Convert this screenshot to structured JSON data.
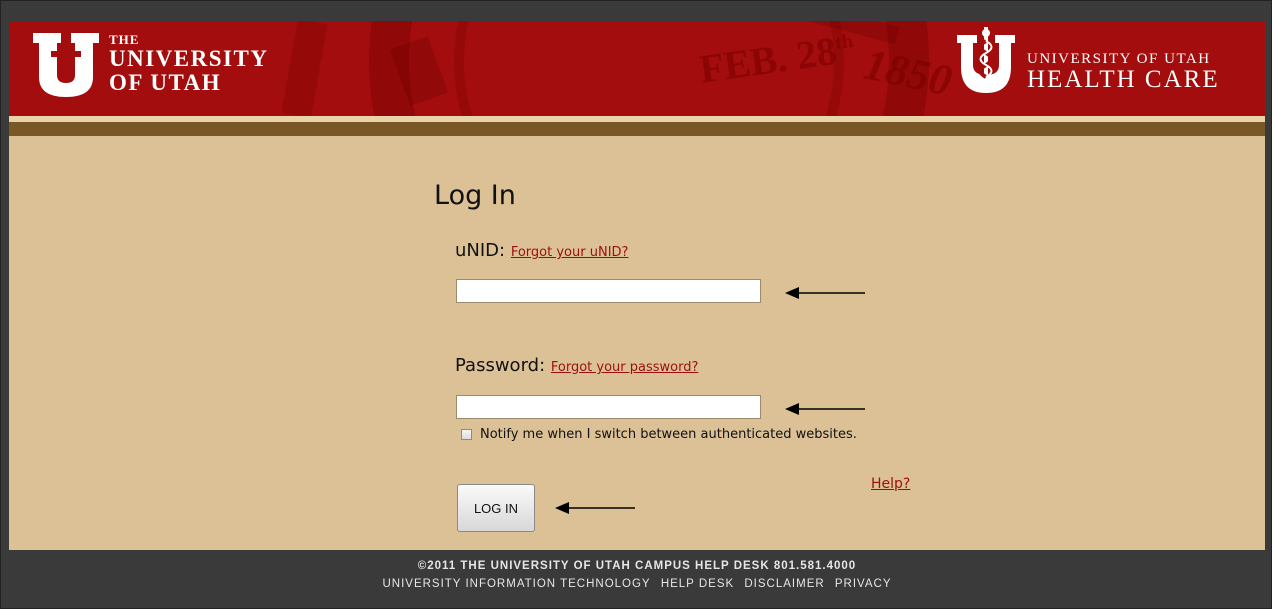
{
  "header": {
    "uu_the": "THE",
    "uu_line1": "UNIVERSITY",
    "uu_line2": "OF UTAH",
    "seal_date": "FEB. 28",
    "seal_sup": "th",
    "seal_year": "1850",
    "hc_line1": "UNIVERSITY OF UTAH",
    "hc_line2": "HEALTH CARE"
  },
  "form": {
    "title": "Log In",
    "unid_label": "uNID:",
    "unid_forgot": "Forgot your uNID?",
    "unid_value": "",
    "password_label": "Password:",
    "password_forgot": "Forgot your password?",
    "password_value": "",
    "notify_label": "Notify me when I switch between authenticated websites.",
    "notify_checked": false,
    "help_link": "Help?",
    "login_button": "LOG IN"
  },
  "footer": {
    "line1": "©2011 THE UNIVERSITY OF UTAH   CAMPUS HELP DESK   801.581.4000",
    "links": [
      "UNIVERSITY INFORMATION TECHNOLOGY",
      "HELP DESK",
      "DISCLAIMER",
      "PRIVACY"
    ]
  },
  "colors": {
    "header_red": "#a30d0d",
    "page_tan": "#dcc197",
    "brown_stripe": "#7a5726",
    "link_red": "#9a1010",
    "footer_bg": "#3a3a3a"
  }
}
